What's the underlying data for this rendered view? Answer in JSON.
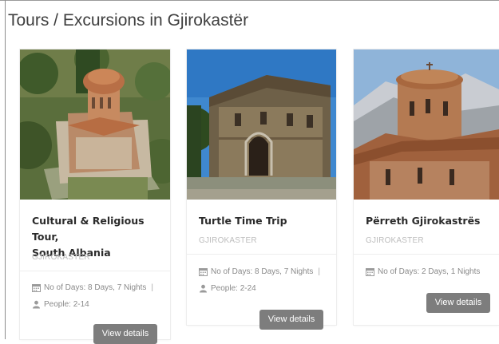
{
  "page": {
    "title": "Tours / Excursions in Gjirokastër"
  },
  "tours": [
    {
      "title_line1": "Cultural & Religious Tour,",
      "title_line2": "South Albania",
      "location": "GJIROKASTER",
      "days": "No of Days: 8 Days, 7 Nights",
      "separator": "|",
      "people": "People: 2-14",
      "button": "View details",
      "photo_icon": "byzantine-church-aerial-photo"
    },
    {
      "title_line1": "Turtle Time Trip",
      "location": "GJIROKASTER",
      "days": "No of Days: 8 Days, 7 Nights",
      "separator": "|",
      "people": "People: 2-24",
      "button": "View details",
      "photo_icon": "stone-church-facade-photo"
    },
    {
      "title_line1": "Përreth Gjirokastrës",
      "location": "GJIROKASTER",
      "days": "No of Days: 2 Days, 1 Nights",
      "button": "View details",
      "photo_icon": "church-dome-mountains-photo"
    }
  ],
  "colors": {
    "button_bg": "#7d7d7d",
    "title_text": "#2b2b2b",
    "muted_text": "#bdbdbd",
    "meta_text": "#8a8a8a"
  }
}
